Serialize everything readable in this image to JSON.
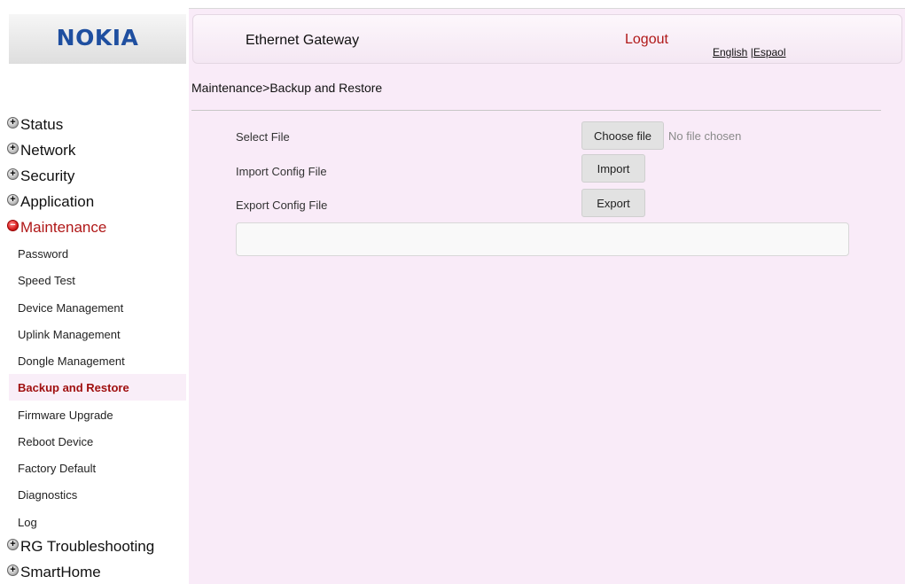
{
  "brand": {
    "logo_text": "NOKIA"
  },
  "header": {
    "title": "Ethernet Gateway",
    "logout": "Logout",
    "lang_english": "English",
    "lang_separator": "|",
    "lang_espanol": "Espaol"
  },
  "breadcrumb": "Maintenance>Backup and Restore",
  "sidebar": {
    "categories": [
      {
        "label": "Status",
        "expanded": false
      },
      {
        "label": "Network",
        "expanded": false
      },
      {
        "label": "Security",
        "expanded": false
      },
      {
        "label": "Application",
        "expanded": false
      },
      {
        "label": "Maintenance",
        "expanded": true
      },
      {
        "label": "RG Troubleshooting",
        "expanded": false
      },
      {
        "label": "SmartHome",
        "expanded": false
      }
    ],
    "maintenance_items": [
      "Password",
      "Speed Test",
      "Device Management",
      "Uplink Management",
      "Dongle Management",
      "Backup and Restore",
      "Firmware Upgrade",
      "Reboot Device",
      "Factory Default",
      "Diagnostics",
      "Log"
    ],
    "selected_item": "Backup and Restore"
  },
  "form": {
    "select_file_label": "Select File",
    "choose_file_button": "Choose file",
    "no_file_text": "No file chosen",
    "import_label": "Import Config File",
    "import_button": "Import",
    "export_label": "Export Config File",
    "export_button": "Export",
    "status_message": ""
  },
  "colors": {
    "brand_blue": "#1f4fa0",
    "accent_red": "#b01818",
    "content_background": "#f9ebf8"
  }
}
